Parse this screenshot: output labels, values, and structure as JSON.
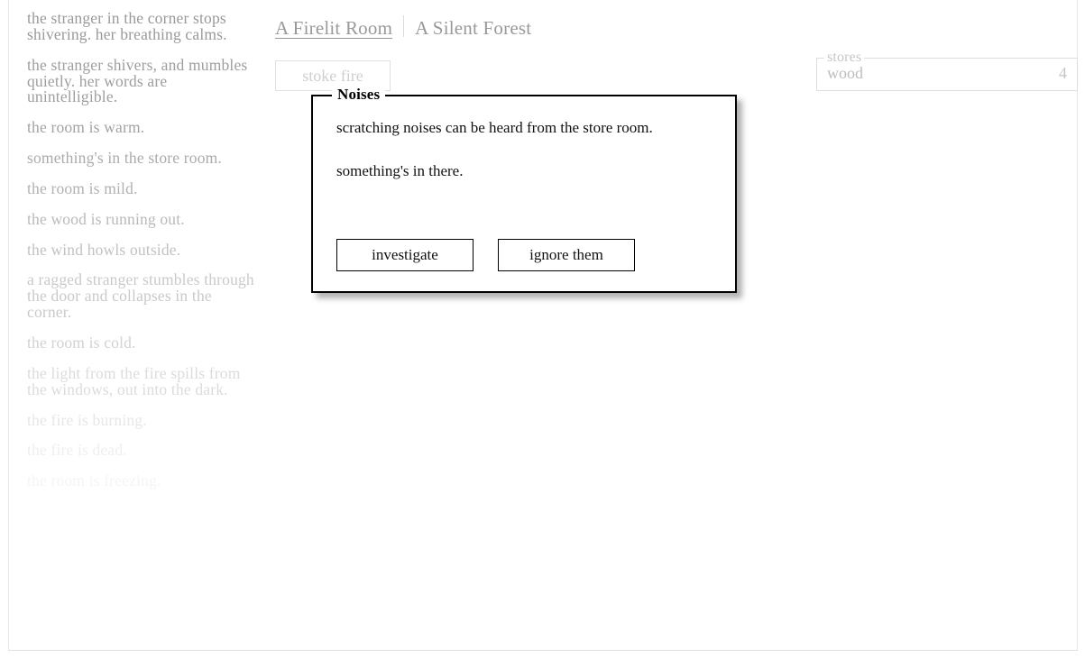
{
  "header": {
    "tabs": [
      {
        "label": "A Firelit Room",
        "active": true
      },
      {
        "label": "A Silent Forest",
        "active": false
      }
    ],
    "divider": "|"
  },
  "notifications": [
    {
      "text": "the stranger in the corner stops shivering. her breathing calms.",
      "opacity": 1.0
    },
    {
      "text": "the stranger shivers, and mumbles quietly. her words are unintelligible.",
      "opacity": 0.95
    },
    {
      "text": "the room is warm.",
      "opacity": 0.9
    },
    {
      "text": "something's in the store room.",
      "opacity": 0.82
    },
    {
      "text": "the room is mild.",
      "opacity": 0.76
    },
    {
      "text": "the wood is running out.",
      "opacity": 0.68
    },
    {
      "text": "the wind howls outside.",
      "opacity": 0.6
    },
    {
      "text": "a ragged stranger stumbles through the door and collapses in the corner.",
      "opacity": 0.52
    },
    {
      "text": "the room is cold.",
      "opacity": 0.44
    },
    {
      "text": "the light from the fire spills from the windows, out into the dark.",
      "opacity": 0.34
    },
    {
      "text": "the fire is burning.",
      "opacity": 0.24
    },
    {
      "text": "the fire is dead.",
      "opacity": 0.16
    },
    {
      "text": "the room is freezing.",
      "opacity": 0.1
    }
  ],
  "room": {
    "stoke_fire_label": "stoke fire",
    "stoke_fire_disabled": true
  },
  "stores": {
    "legend": "stores",
    "rows": [
      {
        "name": "wood",
        "value": "4"
      }
    ]
  },
  "event": {
    "title": "Noises",
    "paragraphs": [
      "scratching noises can be heard from the store room.",
      "something's in there."
    ],
    "buttons": [
      {
        "label": "investigate"
      },
      {
        "label": "ignore them"
      }
    ]
  },
  "colors": {
    "page_background": "#ffffff",
    "log_text": "#999999",
    "header_text": "#999999",
    "disabled_button_text": "#cfcfcf",
    "panel_border": "#dedede",
    "dialog_border": "#000000",
    "dialog_text": "#111111"
  }
}
